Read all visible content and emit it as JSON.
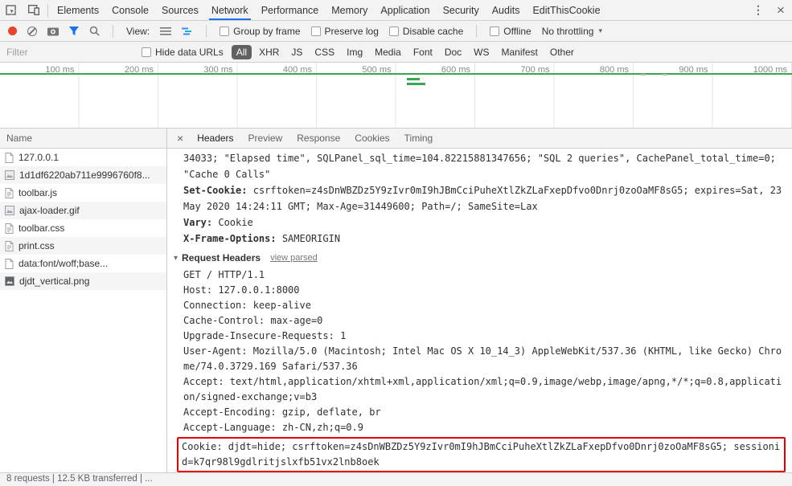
{
  "glyphs": {
    "kebab": "⋮",
    "close": "×",
    "dropdown": "▾",
    "disclosure": "▾"
  },
  "colors": {
    "accent_blue": "#1a73e8",
    "record_red": "#e8442e",
    "event_green": "#3aa655",
    "highlight_red": "#e60000",
    "pill_dark": "#616161"
  },
  "main_tabs": {
    "items": [
      "Elements",
      "Console",
      "Sources",
      "Network",
      "Performance",
      "Memory",
      "Application",
      "Security",
      "Audits",
      "EditThisCookie"
    ],
    "active": "Network"
  },
  "network_toolbar": {
    "view_label": "View:",
    "group_by_frame": "Group by frame",
    "preserve_log": "Preserve log",
    "disable_cache": "Disable cache",
    "offline": "Offline",
    "throttling": "No throttling"
  },
  "filter_bar": {
    "filter_placeholder": "Filter",
    "hide_data_urls": "Hide data URLs",
    "pills": [
      "All",
      "XHR",
      "JS",
      "CSS",
      "Img",
      "Media",
      "Font",
      "Doc",
      "WS",
      "Manifest",
      "Other"
    ],
    "active_pill": "All"
  },
  "overview": {
    "ticks": [
      "100 ms",
      "200 ms",
      "300 ms",
      "400 ms",
      "500 ms",
      "600 ms",
      "700 ms",
      "800 ms",
      "900 ms",
      "1000 ms"
    ]
  },
  "request_list": {
    "header": "Name",
    "items": [
      {
        "name": "127.0.0.1",
        "icon": "document"
      },
      {
        "name": "1d1df6220ab711e9996760f8...",
        "icon": "image"
      },
      {
        "name": "toolbar.js",
        "icon": "document"
      },
      {
        "name": "ajax-loader.gif",
        "icon": "image"
      },
      {
        "name": "toolbar.css",
        "icon": "document"
      },
      {
        "name": "print.css",
        "icon": "document"
      },
      {
        "name": "data:font/woff;base...",
        "icon": "document"
      },
      {
        "name": "djdt_vertical.png",
        "icon": "image-dark"
      }
    ]
  },
  "detail_tabs": {
    "items": [
      "Headers",
      "Preview",
      "Response",
      "Cookies",
      "Timing"
    ],
    "active": "Headers"
  },
  "headers_panel": {
    "response_overflow": "34033; \"Elapsed time\", SQLPanel_sql_time=104.82215881347656; \"SQL 2 queries\", CachePanel_total_time=0; \"Cache 0 Calls\"",
    "response_headers": [
      {
        "name": "Set-Cookie:",
        "value": "csrftoken=z4sDnWBZDz5Y9zIvr0mI9hJBmCciPuheXtlZkZLaFxepDfvo0Dnrj0zoOaMF8sG5; expires=Sat, 23 May 2020 14:24:11 GMT; Max-Age=31449600; Path=/; SameSite=Lax"
      },
      {
        "name": "Vary:",
        "value": "Cookie"
      },
      {
        "name": "X-Frame-Options:",
        "value": "SAMEORIGIN"
      }
    ],
    "request_headers_section": {
      "title": "Request Headers",
      "link": "view parsed"
    },
    "request_headers_raw": [
      "GET / HTTP/1.1",
      "Host: 127.0.0.1:8000",
      "Connection: keep-alive",
      "Cache-Control: max-age=0",
      "Upgrade-Insecure-Requests: 1",
      "User-Agent: Mozilla/5.0 (Macintosh; Intel Mac OS X 10_14_3) AppleWebKit/537.36 (KHTML, like Gecko) Chrome/74.0.3729.169 Safari/537.36",
      "Accept: text/html,application/xhtml+xml,application/xml;q=0.9,image/webp,image/apng,*/*;q=0.8,application/signed-exchange;v=b3",
      "Accept-Encoding: gzip, deflate, br",
      "Accept-Language: zh-CN,zh;q=0.9"
    ],
    "highlighted_header": "Cookie: djdt=hide; csrftoken=z4sDnWBZDz5Y9zIvr0mI9hJBmCciPuheXtlZkZLaFxepDfvo0Dnrj0zoOaMF8sG5; sessionid=k7qr98l9gdlritjslxfb51vx2lnb8oek"
  },
  "status_bar": {
    "text": "8 requests | 12.5 KB transferred | ..."
  }
}
